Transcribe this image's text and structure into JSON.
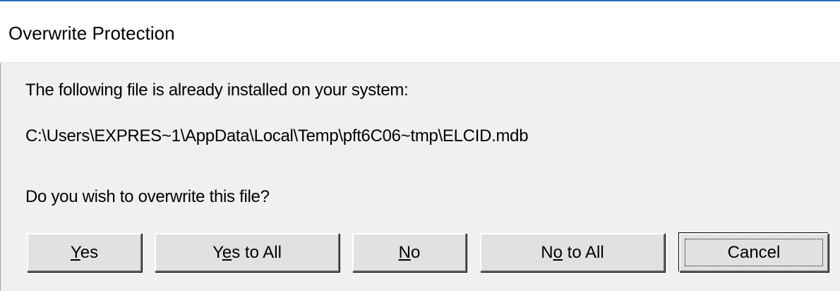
{
  "window": {
    "title": "Overwrite Protection"
  },
  "message": {
    "line1": "The following file is already installed on your system:",
    "path": "C:\\Users\\EXPRES~1\\AppData\\Local\\Temp\\pft6C06~tmp\\ELCID.mdb",
    "question": "Do you wish to overwrite this file?"
  },
  "buttons": {
    "yes": {
      "pre": "",
      "mnemonic": "Y",
      "post": "es"
    },
    "yes_to_all": {
      "pre": "Y",
      "mnemonic": "e",
      "post": "s to All"
    },
    "no": {
      "pre": "",
      "mnemonic": "N",
      "post": "o"
    },
    "no_to_all": {
      "pre": "N",
      "mnemonic": "o",
      "post": " to All"
    },
    "cancel": {
      "label": "Cancel",
      "focused": true
    }
  },
  "colors": {
    "accent_border": "#2b6fb8",
    "title_background": "#ffffff",
    "dialog_background": "#f0f0f0",
    "button_face": "#e1e1e1"
  }
}
